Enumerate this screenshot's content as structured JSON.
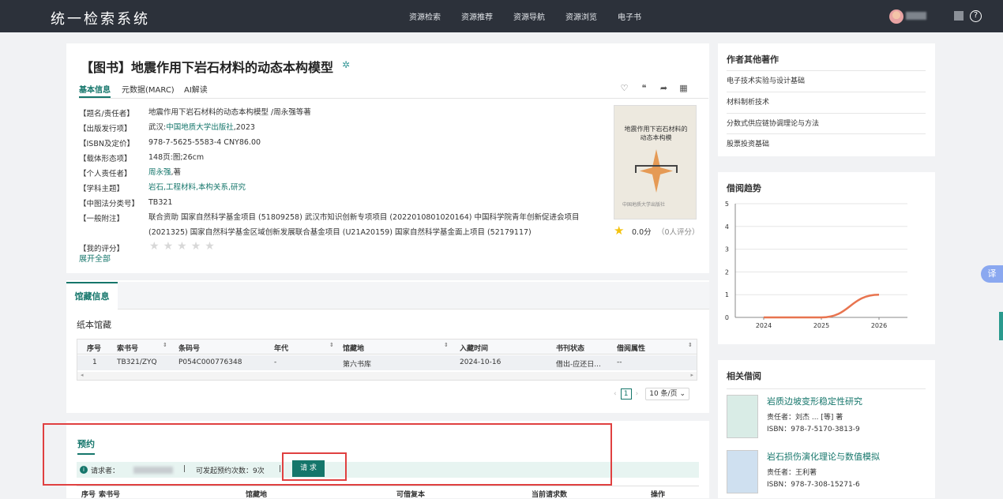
{
  "header": {
    "brand": "统一检索系统",
    "nav": [
      "资源检索",
      "资源推荐",
      "资源导航",
      "资源浏览",
      "电子书"
    ],
    "help_icon": "?"
  },
  "book": {
    "title": "【图书】地震作用下岩石材料的动态本构模型",
    "tabs": [
      "基本信息",
      "元数据(MARC)",
      "AI解读"
    ],
    "fields": [
      {
        "k": "【题名/责任者】",
        "v": "地震作用下岩石材料的动态本构模型 /周永强等著"
      },
      {
        "k": "【出版发行项】",
        "v_prefix": "武汉:",
        "v_link": "中国地质大学出版社",
        "v_suffix": ",2023"
      },
      {
        "k": "【ISBN及定价】",
        "v": "978-7-5625-5583-4 CNY86.00"
      },
      {
        "k": "【载体形态项】",
        "v": "148页:图;26cm"
      },
      {
        "k": "【个人责任者】",
        "v_link": "周永强",
        "v_suffix": ",著"
      },
      {
        "k": "【学科主题】",
        "v_link": "岩石,工程材料,本构关系,研究"
      },
      {
        "k": "【中图法分类号】",
        "v": "TB321"
      },
      {
        "k": "【一般附注】",
        "v": "联合资助 国家自然科学基金项目 (51809258) 武汉市知识创新专项项目 (2022010801020164) 中国科学院青年创新促进会项目 (2021325) 国家自然科学基金区域创新发展联合基金项目 (U21A20159) 国家自然科学基金面上项目 (52179117)"
      },
      {
        "k": "【我的评分】",
        "v": ""
      }
    ],
    "expand_label": "展开全部",
    "cover_title": "地震作用下岩石材料的动态本构模",
    "cover_publisher": "中国地质大学出版社",
    "rating_value": "0.0分",
    "rating_count": "（0人评分）",
    "my_rating_stars": 0
  },
  "holdings": {
    "tab_label": "馆藏信息",
    "section_label": "纸本馆藏",
    "columns": [
      "序号",
      "索书号",
      "条码号",
      "年代",
      "馆藏地",
      "入藏时间",
      "书刊状态",
      "借阅属性"
    ],
    "rows": [
      [
        "1",
        "TB321/ZYQ",
        "P054C000776348",
        "-",
        "第六书库",
        "2024-10-16",
        "借出-应还日...",
        "--"
      ]
    ],
    "page": "1",
    "page_size": "10 条/页"
  },
  "reserve": {
    "title": "预约",
    "requester_label": "请求者：",
    "count_text": "可发起预约次数：9次",
    "request_button": "请 求",
    "columns": [
      "序号",
      "索书号",
      "馆藏地",
      "可借复本",
      "当前请求数",
      "操作"
    ]
  },
  "sidebar": {
    "authors_title": "作者其他著作",
    "authors_items": [
      "电子技术实验与设计基础",
      "材料制析技术",
      "分数式供应链协调理论与方法",
      "股票投资基础"
    ],
    "trend_title": "借阅趋势",
    "related_title": "相关借阅",
    "related": [
      {
        "title": "岩质边坡变形稳定性研究",
        "author": "责任者：刘杰 ... [等] 著",
        "isbn": "ISBN：978-7-5170-3813-9"
      },
      {
        "title": "岩石损伤演化理论与数值模拟",
        "author": "责任者：王利著",
        "isbn": "ISBN：978-7-308-15271-6"
      }
    ]
  },
  "chart_data": {
    "type": "line",
    "x": [
      2024,
      2025,
      2026
    ],
    "series": [
      {
        "values": [
          0,
          0,
          1
        ]
      }
    ],
    "ylim": [
      0,
      5
    ],
    "yticks": [
      0,
      1,
      2,
      3,
      4,
      5
    ],
    "grid": true,
    "color": "#e8744f"
  },
  "translate_label": "译"
}
